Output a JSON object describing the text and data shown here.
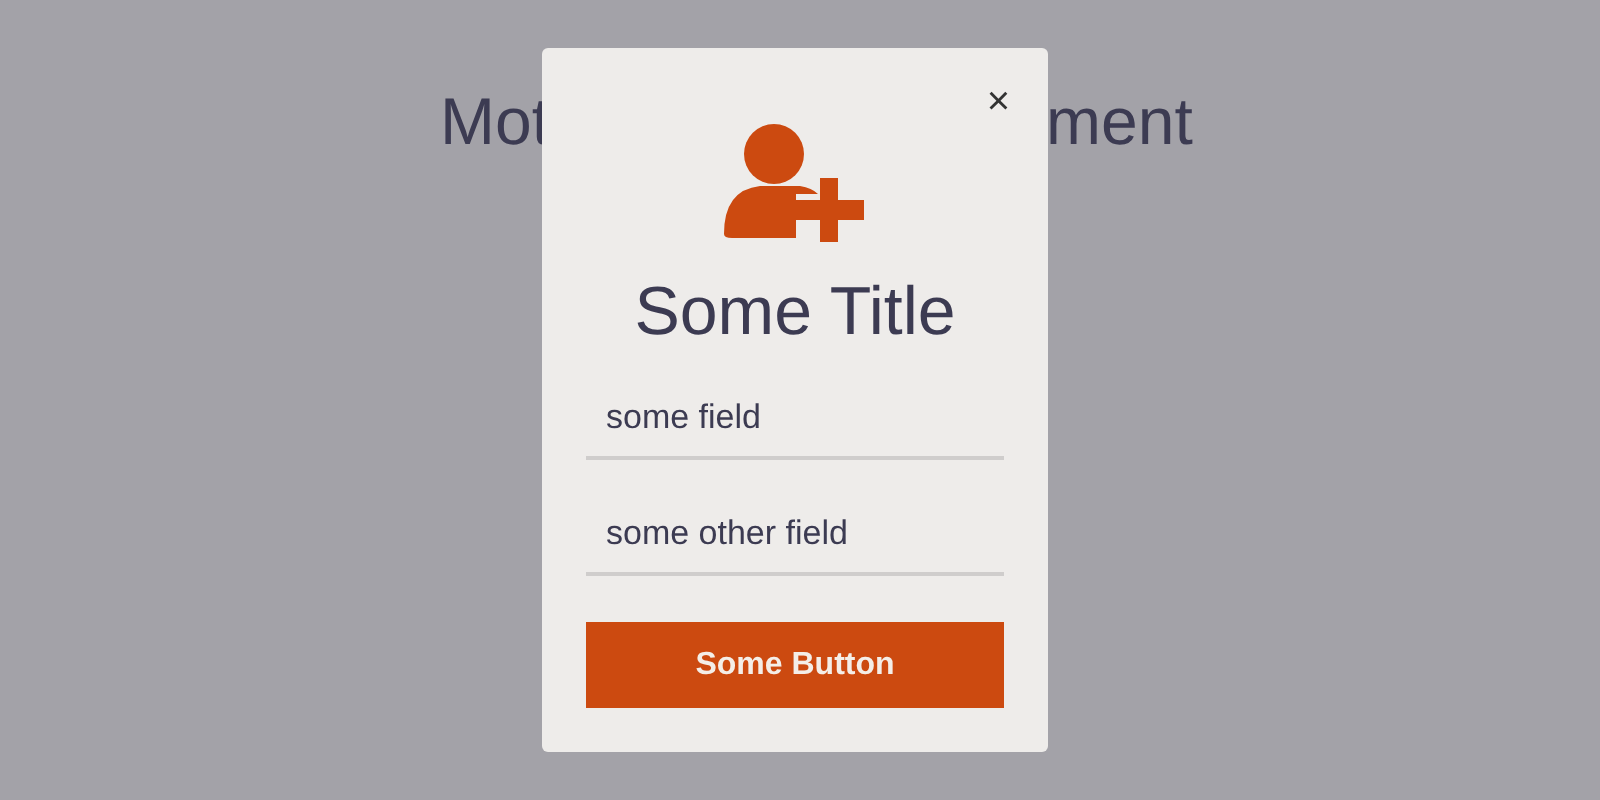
{
  "background_heading": {
    "left_part": "Mot",
    "right_part": "ment"
  },
  "dialog": {
    "close": "×",
    "title": "Some Title",
    "fields": [
      {
        "placeholder": "some field"
      },
      {
        "placeholder": "some other field"
      }
    ],
    "button": "Some Button"
  }
}
